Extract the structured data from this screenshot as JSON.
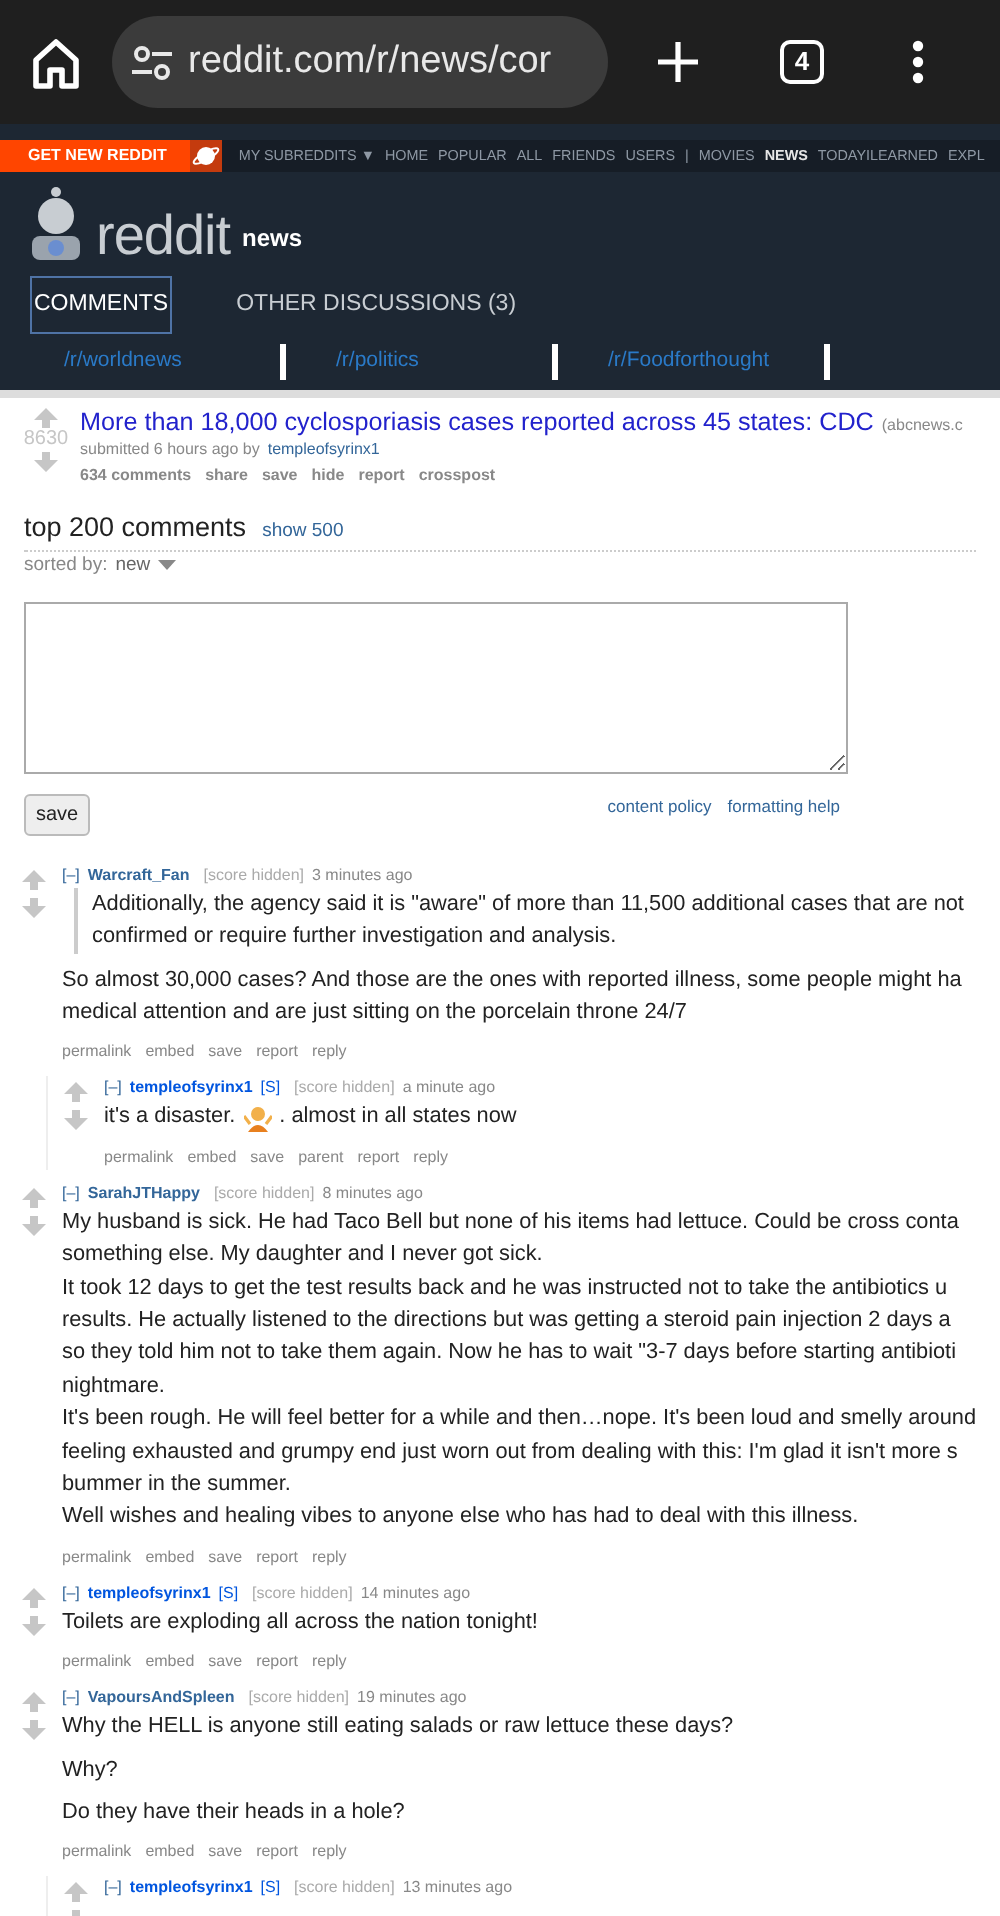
{
  "browser": {
    "url": "reddit.com/r/news/cor",
    "tab_count": "4"
  },
  "header": {
    "get_new_reddit": "GET NEW REDDIT",
    "nav_items": [
      {
        "label": "MY SUBREDDITS ▼",
        "selected": false
      },
      {
        "label": "HOME",
        "selected": false
      },
      {
        "label": "POPULAR",
        "selected": false
      },
      {
        "label": "ALL",
        "selected": false
      },
      {
        "label": "FRIENDS",
        "selected": false
      },
      {
        "label": "USERS",
        "selected": false
      },
      {
        "label": "|",
        "selected": false
      },
      {
        "label": "MOVIES",
        "selected": false
      },
      {
        "label": "NEWS",
        "selected": true
      },
      {
        "label": "TODAYILEARNED",
        "selected": false
      },
      {
        "label": "EXPL",
        "selected": false
      }
    ],
    "logo_text": "reddit",
    "subreddit": "news",
    "tabs": [
      {
        "label": "COMMENTS",
        "selected": true
      },
      {
        "label": "OTHER DISCUSSIONS (3)",
        "selected": false
      }
    ],
    "related": [
      "/r/worldnews",
      "/r/politics",
      "/r/Foodforthought"
    ]
  },
  "post": {
    "score": "8630",
    "title": "More than 18,000 cyclosporiasis cases reported across 45 states: CDC",
    "domain": "(abcnews.c",
    "submitted": "submitted 6 hours ago by",
    "author": "templeofsyrinx1",
    "actions": [
      "634 comments",
      "share",
      "save",
      "hide",
      "report",
      "crosspost"
    ]
  },
  "comment_area": {
    "heading": "top 200 comments",
    "show_more": "show 500",
    "sorted_label": "sorted by:",
    "sort": "new",
    "save_button": "save",
    "links": [
      "content policy",
      "formatting help"
    ]
  },
  "comments": [
    {
      "toggle": "[–]",
      "author": "Warcraft_Fan",
      "submitter": false,
      "score": "[score hidden]",
      "time": "3 minutes ago",
      "paragraphs": [
        {
          "kind": "quote",
          "lines": [
            "Additionally, the agency said it is \"aware\" of more than 11,500 additional cases that are not",
            "confirmed or require further investigation and analysis."
          ]
        },
        {
          "kind": "text",
          "lines": [
            "So almost 30,000 cases? And those are the ones with reported illness, some people might ha",
            "medical attention and are just sitting on the porcelain throne 24/7"
          ]
        }
      ],
      "actions": [
        "permalink",
        "embed",
        "save",
        "report",
        "reply"
      ],
      "children": [
        {
          "toggle": "[–]",
          "author": "templeofsyrinx1",
          "submitter": true,
          "flag": "[S]",
          "score": "[score hidden]",
          "time": "a minute ago",
          "paragraphs": [
            {
              "kind": "text",
              "lines": [
                [
                  {
                    "kind": "text",
                    "text": "it's a disaster."
                  },
                  {
                    "kind": "emoji"
                  },
                  {
                    "kind": "text",
                    "text": ". almost in all states now"
                  }
                ]
              ]
            }
          ],
          "actions": [
            "permalink",
            "embed",
            "save",
            "parent",
            "report",
            "reply"
          ]
        }
      ]
    },
    {
      "toggle": "[–]",
      "author": "SarahJTHappy",
      "submitter": false,
      "score": "[score hidden]",
      "time": "8 minutes ago",
      "paragraphs": [
        {
          "kind": "text",
          "lines": [
            "My husband is sick. He had Taco Bell but none of his items had lettuce. Could be cross conta",
            "something else. My daughter and I never got sick.",
            "It took 12 days to get the test results back and he was instructed not to take the antibiotics u",
            "results. He actually listened to the directions but was getting a steroid pain injection 2 days a",
            "so they told him not to take them again. Now he has to wait \"3-7 days before starting antibioti",
            "nightmare.",
            "It's been rough. He will feel better for a while and then…nope. It's been loud and smelly around",
            "feeling exhausted and grumpy end just worn out from dealing with this: I'm glad it isn't more s",
            "bummer in the summer.",
            "Well wishes and healing vibes to anyone else who has had to deal with this illness."
          ]
        }
      ],
      "actions": [
        "permalink",
        "embed",
        "save",
        "report",
        "reply"
      ]
    },
    {
      "toggle": "[–]",
      "author": "templeofsyrinx1",
      "submitter": true,
      "flag": "[S]",
      "score": "[score hidden]",
      "time": "14 minutes ago",
      "paragraphs": [
        {
          "kind": "text",
          "lines": [
            "Toilets are exploding all across the nation tonight!"
          ]
        }
      ],
      "actions": [
        "permalink",
        "embed",
        "save",
        "report",
        "reply"
      ]
    },
    {
      "toggle": "[–]",
      "author": "VapoursAndSpleen",
      "submitter": false,
      "score": "[score hidden]",
      "time": "19 minutes ago",
      "paragraphs": [
        {
          "kind": "text",
          "lines": [
            "Why the HELL is anyone still eating salads or raw lettuce these days?"
          ]
        },
        {
          "kind": "text",
          "lines": [
            "Why?"
          ]
        },
        {
          "kind": "text",
          "lines": [
            "Do they have their heads in a hole?"
          ]
        }
      ],
      "actions": [
        "permalink",
        "embed",
        "save",
        "report",
        "reply"
      ],
      "children": [
        {
          "toggle": "[–]",
          "author": "templeofsyrinx1",
          "submitter": true,
          "flag": "[S]",
          "score": "[score hidden]",
          "time": "13 minutes ago"
        }
      ]
    }
  ]
}
